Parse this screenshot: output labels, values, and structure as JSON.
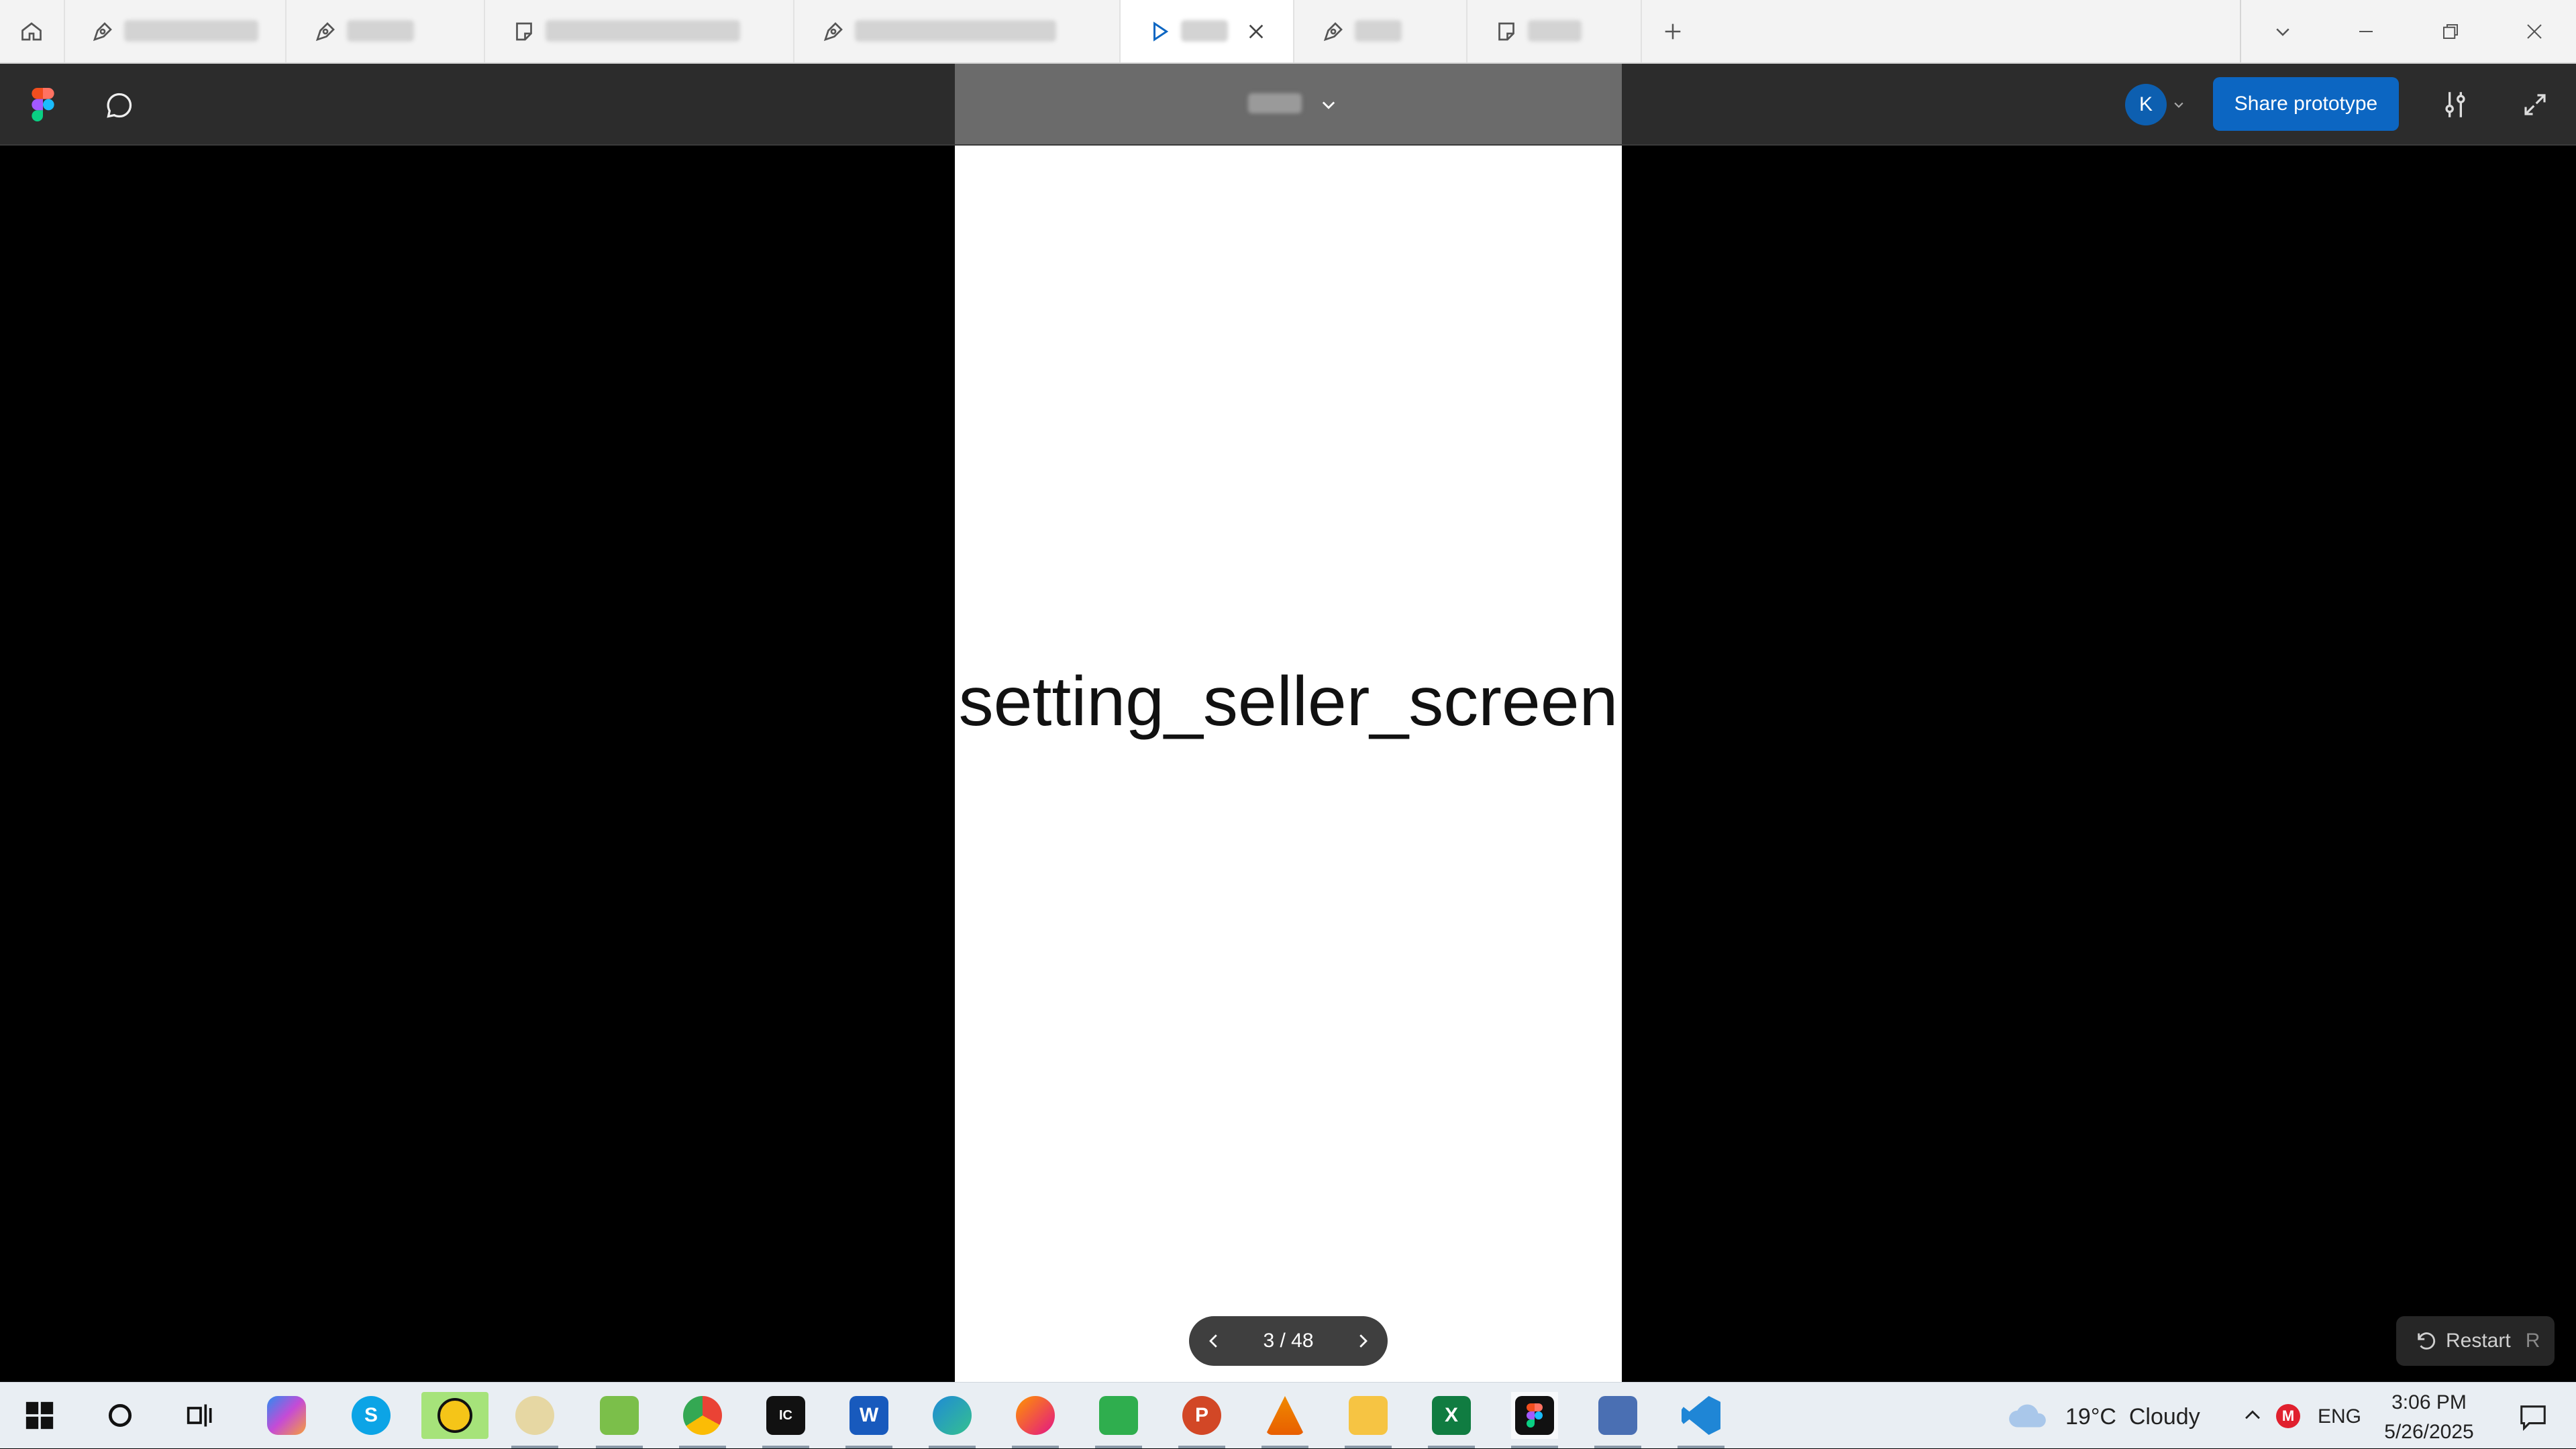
{
  "tabs": [
    {
      "kind": "design",
      "active": false
    },
    {
      "kind": "design",
      "active": false
    },
    {
      "kind": "figjam",
      "active": false
    },
    {
      "kind": "design",
      "active": false
    },
    {
      "kind": "prototype",
      "active": true
    },
    {
      "kind": "design",
      "active": false
    },
    {
      "kind": "figjam",
      "active": false
    }
  ],
  "toolbar": {
    "avatar_initial": "K",
    "share_label": "Share prototype"
  },
  "canvas": {
    "frame_title": "setting_seller_screen"
  },
  "pager": {
    "current": 3,
    "total": 48,
    "label": "3 / 48"
  },
  "restart": {
    "label": "Restart",
    "shortcut": "R"
  },
  "taskbar": {
    "weather": "19°C  Cloudy",
    "language": "ENG",
    "time": "3:06 PM",
    "date": "5/26/2025"
  },
  "colors": {
    "accent": "#0c66c2",
    "canvas_bg": "#000000",
    "toolbar_bg": "#2c2c2c"
  }
}
